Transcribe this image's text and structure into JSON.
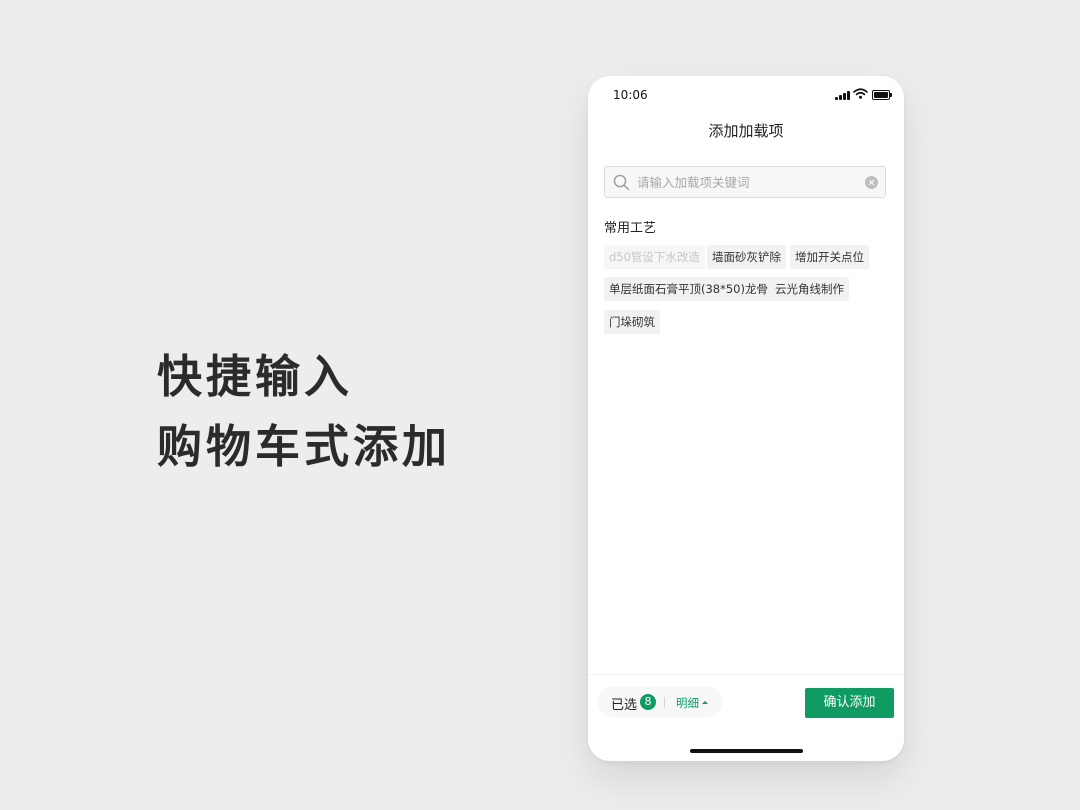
{
  "promo": {
    "line1": "快捷输入",
    "line2": "购物车式添加"
  },
  "status_bar": {
    "time": "10:06",
    "icons": [
      "cellular-signal-icon",
      "wifi-icon",
      "battery-icon"
    ]
  },
  "header": {
    "title": "添加加载项"
  },
  "search": {
    "placeholder": "请输入加载项关键词",
    "value": "",
    "icon": "search-icon",
    "clear_icon": "clear-icon"
  },
  "common_section": {
    "title": "常用工艺",
    "tags": [
      {
        "label": "d50管设下水改造",
        "disabled": true
      },
      {
        "label": "墙面砂灰铲除",
        "disabled": false
      },
      {
        "label": "增加开关点位",
        "disabled": false
      },
      {
        "label": "单层纸面石膏平顶(38*50)龙骨",
        "disabled": false
      },
      {
        "label": "云光角线制作",
        "disabled": false
      },
      {
        "label": "门垛砌筑",
        "disabled": false
      }
    ]
  },
  "footer": {
    "selected_label": "已选",
    "selected_count": "8",
    "detail_label": "明细",
    "confirm_label": "确认添加"
  },
  "colors": {
    "accent": "#0f9b62",
    "background": "#ededed",
    "tag_background": "#f2f2f2"
  }
}
